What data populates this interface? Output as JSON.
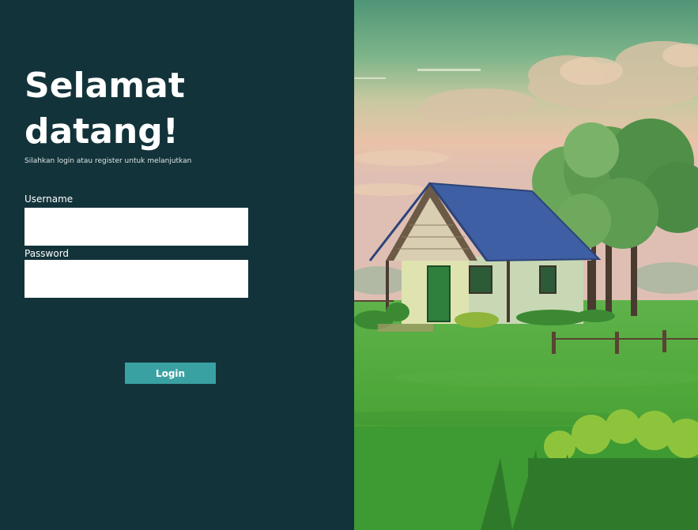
{
  "login": {
    "title_line1": "Selamat",
    "title_line2": "datang!",
    "subtitle": "Silahkan login atau register untuk melanjutkan",
    "username_label": "Username",
    "username_value": "",
    "password_label": "Password",
    "password_value": "",
    "login_button": "Login"
  },
  "colors": {
    "panel_bg": "#13333a",
    "button_bg": "#3aa1a2",
    "roof": "#3e5fa3",
    "grass": "#4fa83a"
  },
  "illustration": {
    "description_icon": "countryside-house-illustration"
  }
}
